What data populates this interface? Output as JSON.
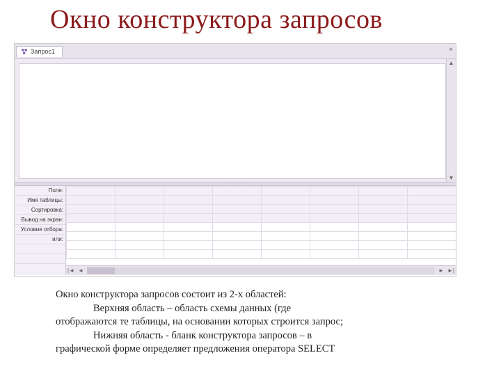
{
  "title": "Окно конструктора запросов",
  "tab": {
    "label": "Запрос1",
    "close_x": "×"
  },
  "scroll": {
    "up": "▲",
    "down": "▼",
    "left": "◄",
    "right": "►",
    "first": "|◄",
    "last": "►|"
  },
  "grid_row_labels": [
    "Поле:",
    "Имя таблицы:",
    "Сортировка:",
    "Вывод на экран:",
    "Условие отбора:",
    "или:"
  ],
  "splitter_grip": "· · · · · ·",
  "caption": {
    "p1": "Окно конструктора запросов состоит из 2-х областей:",
    "p2a": "Верхняя область – область схемы данных (где",
    "p2b": "отображаются те таблицы, на основании которых строится запрос;",
    "p3a": "Нижняя область - бланк конструктора запросов – в",
    "p3b": "графической форме определяет предложения оператора SELECT"
  }
}
